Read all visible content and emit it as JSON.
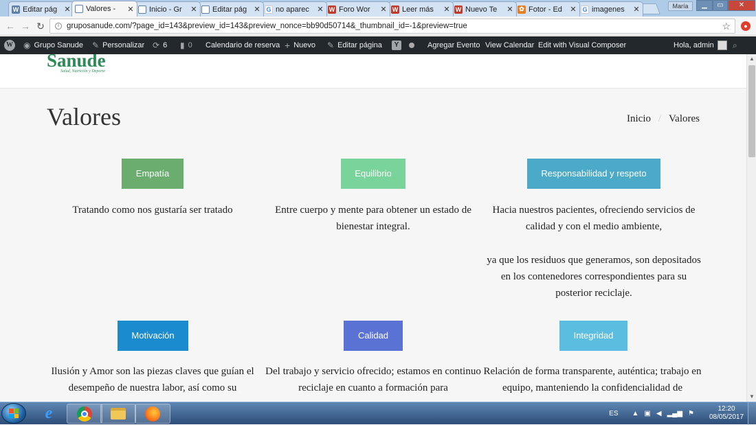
{
  "browser": {
    "tabs": [
      {
        "label": "Editar pág",
        "icon": "wordpress-icon",
        "color": "#5d7fa5"
      },
      {
        "label": "Valores -",
        "icon": "page-icon",
        "color": "#5d7fa5",
        "active": true
      },
      {
        "label": "Inicio - Gr",
        "icon": "page-icon",
        "color": "#5d7fa5"
      },
      {
        "label": "Editar pág",
        "icon": "page-icon",
        "color": "#5d7fa5"
      },
      {
        "label": "no aparec",
        "icon": "google-icon",
        "color": "#4285f4"
      },
      {
        "label": "Foro Wor",
        "icon": "w-icon",
        "color": "#c0392b"
      },
      {
        "label": "Leer más",
        "icon": "w-icon",
        "color": "#c0392b"
      },
      {
        "label": "Nuevo Te",
        "icon": "w-icon",
        "color": "#c0392b"
      },
      {
        "label": "Fotor - Ed",
        "icon": "fotor-icon",
        "color": "#e67e22"
      },
      {
        "label": "imagenes",
        "icon": "google-icon",
        "color": "#4285f4"
      }
    ],
    "tab_close": "✕",
    "user_chip": "María",
    "url": "gruposanude.com/?page_id=143&preview_id=143&preview_nonce=bb90d50714&_thumbnail_id=-1&preview=true"
  },
  "adminbar": {
    "site": "Grupo Sanude",
    "customize": "Personalizar",
    "updates": "6",
    "comments": "0",
    "calendar": "Calendario de reserva",
    "new": "Nuevo",
    "edit": "Editar página",
    "add_event": "Agregar Evento",
    "view_calendar": "View Calendar",
    "visual_composer": "Edit with Visual Composer",
    "greeting": "Hola, admin"
  },
  "page": {
    "logo": "Sanude",
    "logo_tag": "Salud, Nutrición y Deporte",
    "title": "Valores",
    "breadcrumb": {
      "home": "Inicio",
      "sep": "/",
      "current": "Valores"
    }
  },
  "values": [
    {
      "label": "Empatía",
      "color": "#6aad6e",
      "text": "Tratando como nos gustaría ser tratado"
    },
    {
      "label": "Equilibrio",
      "color": "#78d49a",
      "text": "Entre cuerpo y mente para obtener un estado de bienestar integral."
    },
    {
      "label": "Responsabilidad y respeto",
      "color": "#4aaac8",
      "text": "Hacia nuestros pacientes, ofreciendo servicios de calidad y con el medio ambiente,",
      "text2": "ya que los residuos que generamos, son depositados en los contenedores correspondientes para su posterior reciclaje."
    },
    {
      "label": "Motivación",
      "color": "#1b8bd0",
      "text": "Ilusión y Amor son las piezas claves que guían el desempeño de nuestra labor, así como su"
    },
    {
      "label": "Calidad",
      "color": "#5a72d4",
      "text": "Del trabajo y servicio ofrecido; estamos en continuo reciclaje en cuanto a formación para"
    },
    {
      "label": "Integridad",
      "color": "#5bbde0",
      "text": "Relación de forma transparente, auténtica; trabajo en equipo, manteniendo la confidencialidad de"
    }
  ],
  "taskbar": {
    "language": "ES",
    "time": "12:20",
    "date": "08/05/2017"
  }
}
